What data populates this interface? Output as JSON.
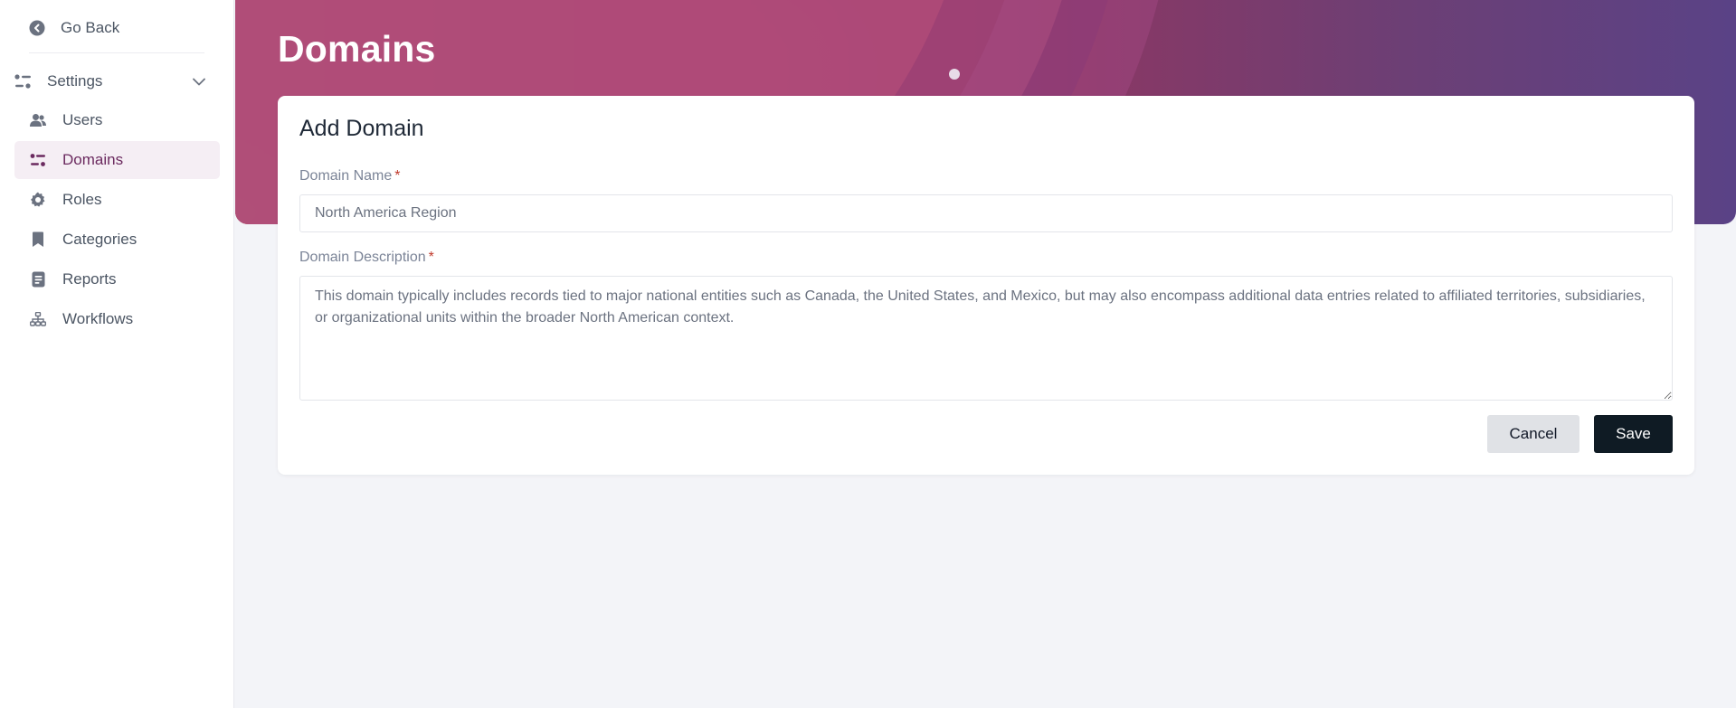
{
  "sidebar": {
    "go_back": {
      "label": "Go Back",
      "icon": "chevron-left-circle-icon"
    },
    "settings": {
      "label": "Settings",
      "icon": "sliders-icon",
      "expanded": true
    },
    "items": [
      {
        "label": "Users",
        "icon": "users-icon",
        "active": false
      },
      {
        "label": "Domains",
        "icon": "sliders-icon",
        "active": true
      },
      {
        "label": "Roles",
        "icon": "gear-icon",
        "active": false
      },
      {
        "label": "Categories",
        "icon": "bookmark-icon",
        "active": false
      },
      {
        "label": "Reports",
        "icon": "report-icon",
        "active": false
      },
      {
        "label": "Workflows",
        "icon": "hierarchy-icon",
        "active": false
      }
    ]
  },
  "page": {
    "title": "Domains"
  },
  "form": {
    "title": "Add Domain",
    "domain_name": {
      "label": "Domain Name",
      "required_mark": "*",
      "value": "North America Region"
    },
    "domain_description": {
      "label": "Domain Description",
      "required_mark": "*",
      "value": "This domain typically includes records tied to major national entities such as Canada, the United States, and Mexico, but may also encompass additional data entries related to affiliated territories, subsidiaries, or organizational units within the broader North American context."
    },
    "cancel_label": "Cancel",
    "save_label": "Save"
  },
  "colors": {
    "accent_active": "#6b2a5f",
    "active_bg": "#f5eef4",
    "save_button": "#0f1b24",
    "required": "#c0392b"
  }
}
